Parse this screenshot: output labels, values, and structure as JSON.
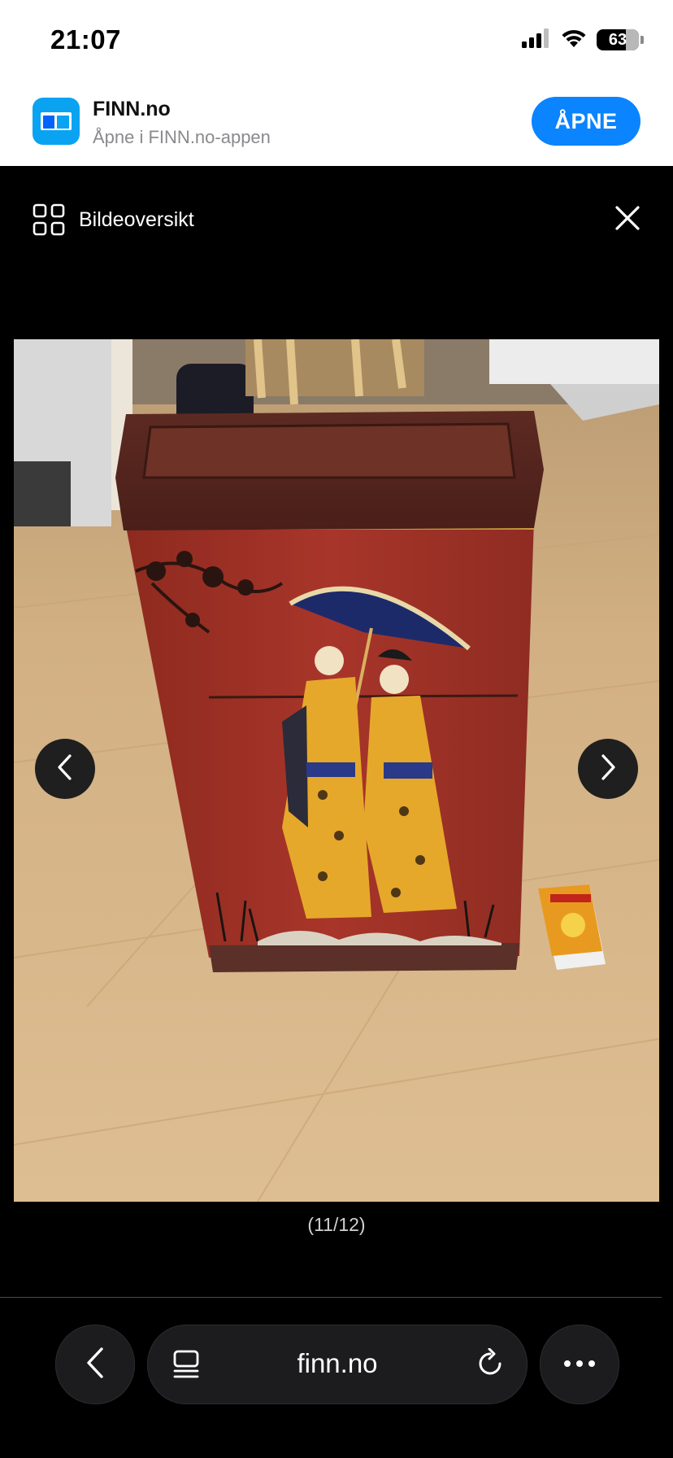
{
  "status_bar": {
    "time": "21:07",
    "battery_percent": "63",
    "icons": [
      "signal-icon",
      "wifi-icon",
      "battery-icon"
    ]
  },
  "app_banner": {
    "app_name": "FINN.no",
    "subtitle": "Åpne i FINN.no-appen",
    "open_label": "ÅPNE",
    "icon": "finn-app-icon",
    "accent_color": "#0a84ff",
    "icon_color": "#0aa3f2"
  },
  "viewer": {
    "overview_label": "Bildeoversikt",
    "overview_icon": "grid-icon",
    "close_icon": "close-icon",
    "prev_icon": "chevron-left-icon",
    "next_icon": "chevron-right-icon",
    "counter": "(11/12)"
  },
  "browser": {
    "url": "finn.no",
    "back_icon": "chevron-left-icon",
    "tabs_icon": "tabs-icon",
    "reload_icon": "reload-icon",
    "more_icon": "more-icon"
  }
}
